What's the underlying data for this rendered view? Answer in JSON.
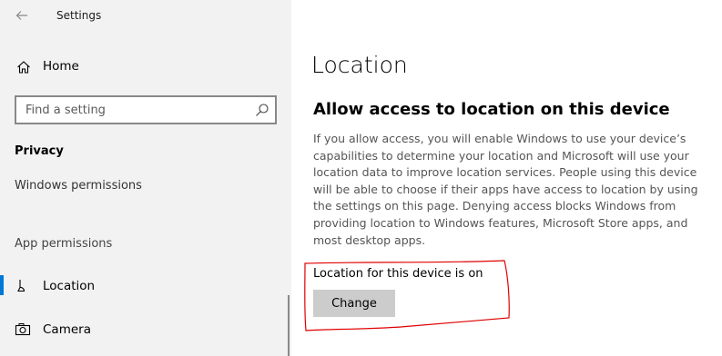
{
  "window": {
    "title": "Settings"
  },
  "sidebar": {
    "home_label": "Home",
    "search": {
      "placeholder": "Find a setting",
      "value": ""
    },
    "section_header": "Privacy",
    "windows_permissions_label": "Windows permissions",
    "app_permissions_label": "App permissions",
    "items": [
      {
        "label": "Location",
        "icon": "location-icon",
        "selected": true
      },
      {
        "label": "Camera",
        "icon": "camera-icon",
        "selected": false
      }
    ]
  },
  "main": {
    "page_title": "Location",
    "section_title": "Allow access to location on this device",
    "description": "If you allow access, you will enable Windows to use your device’s capabilities to determine your location and Microsoft will use your location data to improve location services. People using this device will be able to choose if their apps have access to location by using the settings on this page. Denying access blocks Windows from providing location to Windows features, Microsoft Store apps, and most desktop apps.",
    "status_text": "Location for this device is on",
    "change_button_label": "Change"
  },
  "colors": {
    "sidebar_bg": "#f2f2f2",
    "accent": "#0078d7",
    "annotation": "#e00000",
    "button_bg": "#cccccc"
  }
}
